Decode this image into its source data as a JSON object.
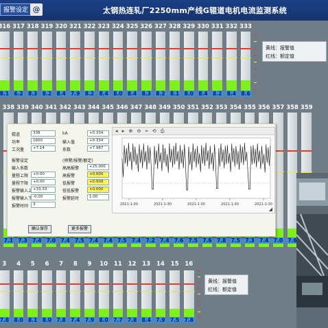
{
  "header": {
    "alarm_button": "报警设定",
    "app_icon": "@",
    "title": "太钢热连轧厂2250mm产线G辊道电机电流监测系统"
  },
  "panels": [
    {
      "channels": [
        "316",
        "317",
        "318",
        "319",
        "320",
        "321",
        "322",
        "323",
        "324",
        "325",
        "326",
        "327",
        "328",
        "329",
        "330",
        "331",
        "332",
        "333"
      ],
      "values": [
        "8.1",
        "6.2",
        "8.3",
        "8.2",
        "8.4",
        "7.9",
        "8.2",
        "8.4",
        "8.0",
        "8.4",
        "8.3",
        "8.2",
        "8.1",
        "8.0",
        "8.4",
        "8.2",
        "8.4",
        "8.6"
      ],
      "levels": [
        0.17,
        0.17,
        0.17,
        0.17,
        0.17,
        0.17,
        0.17,
        0.17,
        0.17,
        0.17,
        0.17,
        0.17,
        0.17,
        0.17,
        0.17,
        0.17,
        0.17,
        0.17
      ]
    },
    {
      "channels": [
        "338",
        "339",
        "340",
        "341",
        "342",
        "343",
        "344",
        "345",
        "346",
        "347",
        "348",
        "349",
        "350",
        "351",
        "352",
        "353",
        "354",
        "355",
        "356",
        "357",
        "358",
        "359"
      ],
      "values": [
        "7.1",
        "7.3",
        "7.4",
        "7.0",
        "7.4",
        "7.5",
        "7.4",
        "7.4",
        "7.5",
        "7.4",
        "7.2",
        "7.4",
        "7.6",
        "7.5",
        "7.6",
        "7.8",
        "7.5",
        "7.3",
        "7.4",
        "7.0",
        "7.6",
        "7.9"
      ],
      "levels": [
        0.14,
        0.14,
        0.14,
        0.14,
        0.14,
        0.14,
        0.14,
        0.14,
        0.14,
        0.14,
        0.14,
        0.14,
        0.14,
        0.14,
        0.14,
        0.14,
        0.14,
        0.14,
        0.14,
        0.14,
        0.14,
        0.14
      ]
    },
    {
      "channels": [
        "3",
        "4",
        "5",
        "6",
        "7",
        "8",
        "9",
        "10",
        "11",
        "12",
        "13",
        "14",
        "15",
        "16"
      ],
      "values": [
        "7.8",
        "8.0",
        "8.1",
        "8.0",
        "7.8",
        "7.4",
        "7.9",
        "8.0",
        "7.7",
        "7.8",
        "8.4",
        "7.9",
        "7.5",
        "7.8"
      ],
      "levels": [
        0.17,
        0.17,
        0.17,
        0.17,
        0.17,
        0.17,
        0.17,
        0.17,
        0.17,
        0.17,
        0.17,
        0.17,
        0.17,
        0.17
      ]
    }
  ],
  "legend": {
    "line1": "黄线：报警值",
    "line2": "红线：额定值"
  },
  "popup": {
    "left_rows": [
      {
        "label": "辊道",
        "value": "338"
      },
      {
        "label": "功率",
        "value": "1600"
      },
      {
        "label": "工况量",
        "value": "+7.14"
      },
      {
        "label": "报警设定",
        "value": ""
      },
      {
        "label": "输入系数",
        "value": ""
      },
      {
        "label": "量程上限",
        "value": "+0.00"
      },
      {
        "label": "量程下限",
        "value": "+0.00"
      },
      {
        "label": "报警输入上限",
        "value": "+33.33"
      },
      {
        "label": "报警输入下限",
        "value": "-0.00"
      },
      {
        "label": "报警时间",
        "value": "3"
      }
    ],
    "mid_rows": [
      {
        "label": "kA",
        "value": "+0.334"
      },
      {
        "label": "输入值",
        "value": "+0.334"
      },
      {
        "label": "系数",
        "value": "+7.987"
      },
      {
        "label": "(预警/报警/额定)",
        "value": ""
      },
      {
        "label": "高高报警",
        "value": "+25.000"
      },
      {
        "label": "高报警",
        "value": "+0.000"
      },
      {
        "label": "低报警",
        "value": "+0.000"
      },
      {
        "label": "低低报警",
        "value": "+0.000"
      },
      {
        "label": "报警延时",
        "value": "1.00"
      }
    ],
    "buttons": [
      "确认保存",
      "更多报警"
    ]
  },
  "chart_window": {
    "toolbar": "◂ ▸ ⊕ ⊖ ⌖ ⟲ ⎙",
    "resize_glyph": "◢"
  },
  "chart_data": {
    "type": "line",
    "title": "",
    "xlabel": "",
    "ylabel": "",
    "x": [
      "2021-1-30",
      "2021-1-30",
      "2021-1-30",
      "2021-1-30",
      "2021-1-30"
    ],
    "series": [
      {
        "values": [
          5.2,
          7.0,
          6.6,
          7.3,
          6.1,
          7.2,
          6.8,
          5.9,
          7.1,
          6.4,
          7.2,
          6.2,
          7.0,
          6.7,
          1.2,
          6.9,
          6.3,
          7.2,
          6.0,
          7.1,
          6.6,
          5.8,
          7.2,
          6.5,
          6.9,
          7.3,
          6.2,
          7.0,
          6.4,
          7.1,
          1.1,
          6.8,
          6.1,
          7.2,
          6.5,
          6.9,
          5.9,
          7.0,
          6.7,
          7.3,
          6.3,
          6.9,
          6.0,
          7.1,
          1.3,
          6.6,
          7.2,
          6.4,
          6.9,
          7.0,
          5.9,
          7.2,
          6.6,
          6.9,
          6.2,
          7.1,
          6.8,
          7.3,
          6.1,
          1.2,
          6.9,
          7.0,
          6.5,
          7.2,
          6.3,
          6.9,
          5.8,
          7.1,
          6.7,
          6.9
        ]
      }
    ],
    "ylim": [
      0,
      8
    ],
    "colors": {
      "series": "#222222",
      "grid": "#9e9e9e"
    }
  },
  "colors": {
    "title_bar": "#1c3f86",
    "bar_fill": "#7ef01c",
    "rated_line": "#e53b2a",
    "alarm_line": "#f2e42a",
    "value_badge": "#3b8fd8"
  }
}
